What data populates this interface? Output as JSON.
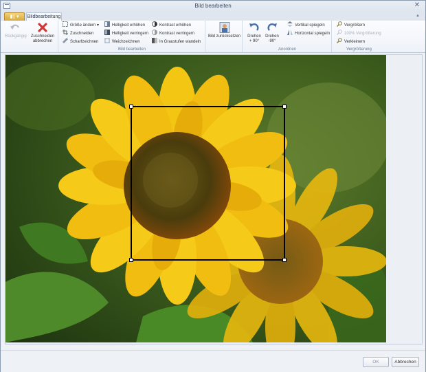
{
  "window": {
    "title": "Bild bearbeiten"
  },
  "tabs": {
    "app_menu_label": "▮▯ ▾",
    "active_tab": "Bildbearbeitung"
  },
  "ribbon": {
    "undo": {
      "label": "Rückgängig"
    },
    "crop_cancel": {
      "label_line1": "Zuschneiden",
      "label_line2": "abbrechen"
    },
    "edit_group": {
      "label": "Bild bearbeiten",
      "resize": "Größe ändern",
      "crop": "Zuschneiden",
      "sharpen": "Scharfzeichnen",
      "brightness_up": "Helligkeit erhöhen",
      "brightness_down": "Helligkeit verringern",
      "soften": "Weichzeichnen",
      "contrast_up": "Kontrast erhöhen",
      "contrast_down": "Kontrast verringern",
      "grayscale": "In Graustufen wandeln"
    },
    "reset": {
      "label": "Bild zurücksetzen"
    },
    "arrange_group": {
      "label": "Anordnen",
      "rotate_left_l1": "Drehen",
      "rotate_left_l2": "+ 90°",
      "rotate_right_l1": "Drehen",
      "rotate_right_l2": "-90°",
      "flip_v": "Vertikal spiegeln",
      "flip_h": "Horizontal spiegeln"
    },
    "zoom_group": {
      "label": "Vergrößerung",
      "zoom_in": "Vergrößern",
      "zoom_100": "100% Vergrößerung",
      "zoom_out": "Verkleinern"
    }
  },
  "footer": {
    "ok_label": "OK",
    "cancel_label": "Abbrechen"
  },
  "colors": {
    "accent": "#d9a93a",
    "crop_border": "#000000",
    "petal": "#f3c614",
    "center": "#5a4a12"
  }
}
